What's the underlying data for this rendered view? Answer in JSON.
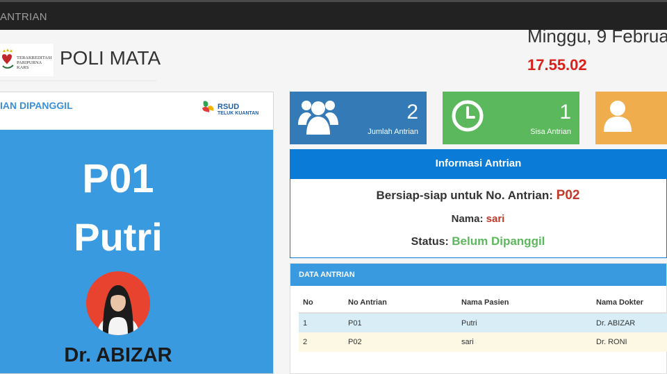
{
  "navbar": {
    "brand": "ANTRIAN"
  },
  "header": {
    "logo_text": "TERAKREDITASI PARIPURNA KARS",
    "title": "POLI MATA",
    "date": "Minggu, 9 Februa",
    "clock": "17.55.02"
  },
  "call_panel": {
    "title": "IAN DIPANGGIL",
    "hospital_logo": {
      "name": "RSUD",
      "subtitle": "TELUK KUANTAN"
    },
    "queue_number": "P01",
    "patient_name": "Putri",
    "doctor": "Dr. ABIZAR"
  },
  "stats": [
    {
      "value": "2",
      "label": "Jumlah Antrian",
      "icon": "users-icon",
      "color": "#337ab7"
    },
    {
      "value": "1",
      "label": "Sisa Antrian",
      "icon": "clock-icon",
      "color": "#5cb85c"
    },
    {
      "value": "",
      "label": "",
      "icon": "user-icon",
      "color": "#f0ad4e"
    }
  ],
  "info": {
    "title": "Informasi Antrian",
    "prepare_label": "Bersiap-siap untuk No. Antrian:",
    "prepare_number": "P02",
    "name_label": "Nama:",
    "name_value": "sari",
    "status_label": "Status:",
    "status_value": "Belum Dipanggil"
  },
  "data_table": {
    "title": "DATA ANTRIAN",
    "headers": [
      "No",
      "No Antrian",
      "Nama Pasien",
      "Nama Dokter"
    ],
    "rows": [
      [
        "1",
        "P01",
        "Putri",
        "Dr. ABIZAR"
      ],
      [
        "2",
        "P02",
        "sari",
        "Dr. RONI"
      ]
    ]
  }
}
